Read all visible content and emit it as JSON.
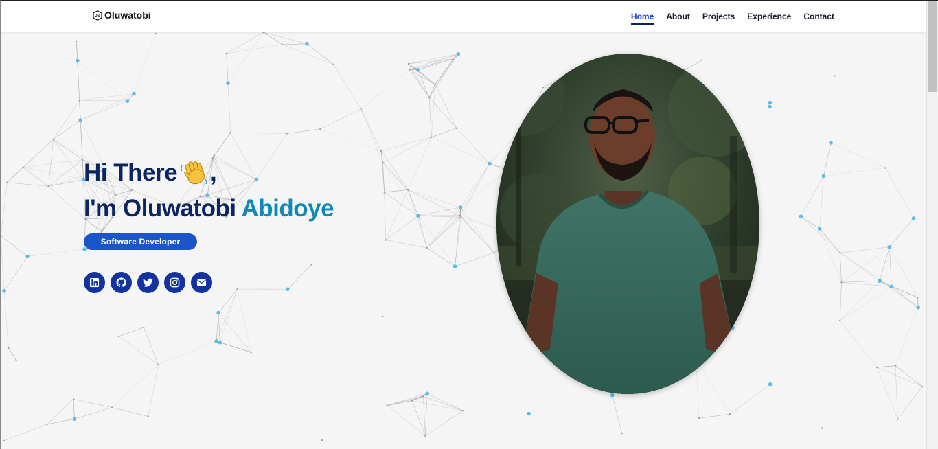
{
  "brand": {
    "name": "Oluwatobi",
    "icon": "js-hexagon-icon"
  },
  "nav": {
    "items": [
      {
        "label": "Home",
        "active": true
      },
      {
        "label": "About",
        "active": false
      },
      {
        "label": "Projects",
        "active": false
      },
      {
        "label": "Experience",
        "active": false
      },
      {
        "label": "Contact",
        "active": false
      }
    ]
  },
  "hero": {
    "greeting": "Hi There",
    "greeting_suffix": ",",
    "wave_icon": "waving-hand-emoji-icon",
    "intro_prefix": "I'm",
    "first_name": "Oluwatobi",
    "last_name": "Abidoye",
    "role": "Software Developer",
    "socials": [
      {
        "name": "linkedin-icon"
      },
      {
        "name": "github-icon"
      },
      {
        "name": "twitter-icon"
      },
      {
        "name": "instagram-icon"
      },
      {
        "name": "email-icon"
      }
    ]
  },
  "colors": {
    "primary_dark": "#0b2560",
    "accent_teal": "#1289b5",
    "badge_blue": "#1a55c9",
    "social_blue": "#1334a0",
    "nav_active": "#1746c9",
    "dot_blue": "#5bbde8"
  }
}
